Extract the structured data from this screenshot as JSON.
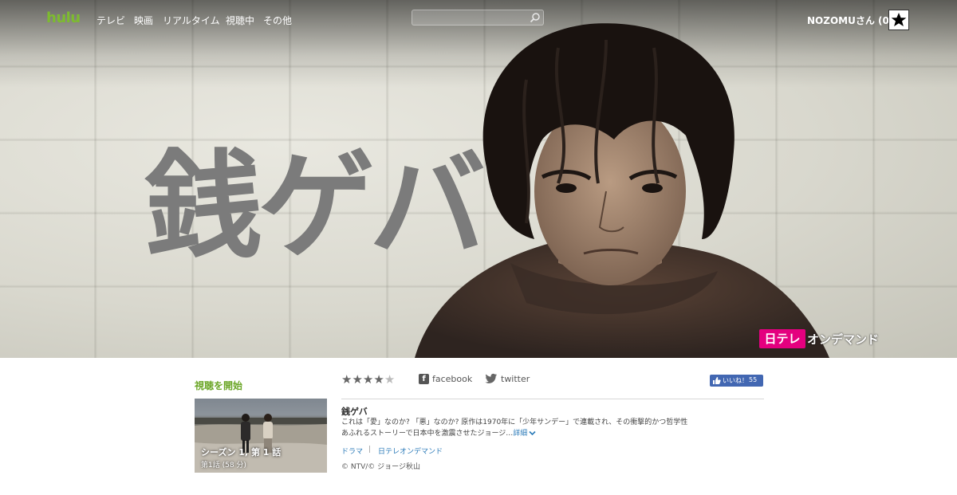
{
  "header": {
    "logo": "hulu",
    "nav": [
      "テレビ",
      "映画",
      "リアルタイム",
      "視聴中",
      "その他"
    ],
    "search": {
      "value": "",
      "placeholder": ""
    },
    "user": "NOZOMUさん (0)"
  },
  "hero": {
    "title": "銭ゲバ",
    "network_badge": {
      "box": "日テレ",
      "text": "オンデマンド"
    }
  },
  "watch": {
    "label": "視聴を開始",
    "episode": {
      "title": "シーズン 1, 第 1 話",
      "subtitle": "第1話 (58 分)"
    }
  },
  "show": {
    "rating": {
      "value": 4,
      "max": 5
    },
    "share": {
      "facebook": "facebook",
      "twitter": "twitter"
    },
    "like": {
      "label": "いいね！",
      "count": "55"
    },
    "title": "銭ゲバ",
    "description": "これは「愛」なのか? 「悪」なのか? 原作は1970年に「少年サンデー」で連載され、その衝撃的かつ哲学性あふれるストーリーで日本中を激震させたジョージ…",
    "more": "詳細",
    "categories": [
      "ドラマ",
      "日テレオンデマンド"
    ],
    "copyright": "© NTV/© ジョージ秋山"
  },
  "colors": {
    "brand_green": "#7dbb2f",
    "watch_label": "#6aa525",
    "link": "#2a7ab8",
    "facebook": "#4267b2",
    "ntv_pink": "#e4007f"
  }
}
